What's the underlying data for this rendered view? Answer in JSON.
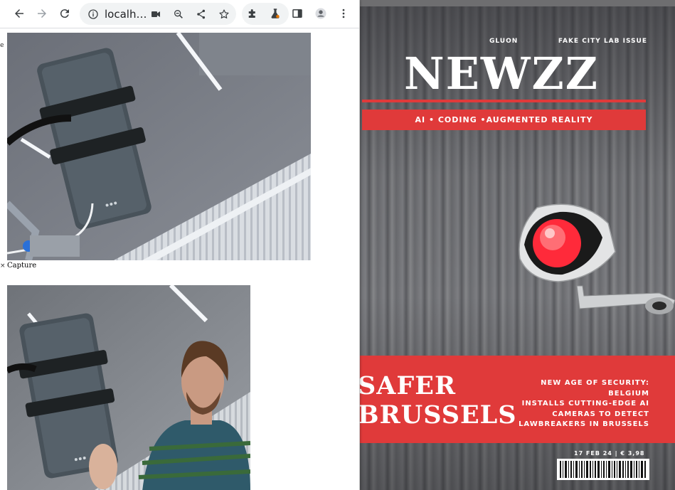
{
  "browser": {
    "url": "localh…",
    "icons": [
      "back-arrow-icon",
      "forward-arrow-icon",
      "reload-icon",
      "info-icon",
      "camera-icon",
      "zoom-icon",
      "share-icon",
      "star-icon",
      "puzzle-icon",
      "flask-icon",
      "sidepanel-icon",
      "profile-icon",
      "kebab-menu-icon"
    ]
  },
  "page": {
    "capture_label": "Capture",
    "edge_glyphs": [
      "e",
      "×"
    ]
  },
  "magazine": {
    "brand": "GLUON",
    "issue": "FAKE CITY LAB ISSUE",
    "title": "NEWZZ",
    "band": "AI • CODING  •AUGMENTED REALITY",
    "headline_line1": "SAFER",
    "headline_line2": "BRUSSELS",
    "sub_line1": "NEW AGE OF SECURITY: BELGIUM",
    "sub_line2": "INSTALLS CUTTING-EDGE AI",
    "sub_line3": "CAMERAS TO DETECT",
    "sub_line4": "LAWBREAKERS IN BRUSSELS",
    "price": "17 FEB 24 | € 3,98",
    "accent": "#e03a3a"
  }
}
